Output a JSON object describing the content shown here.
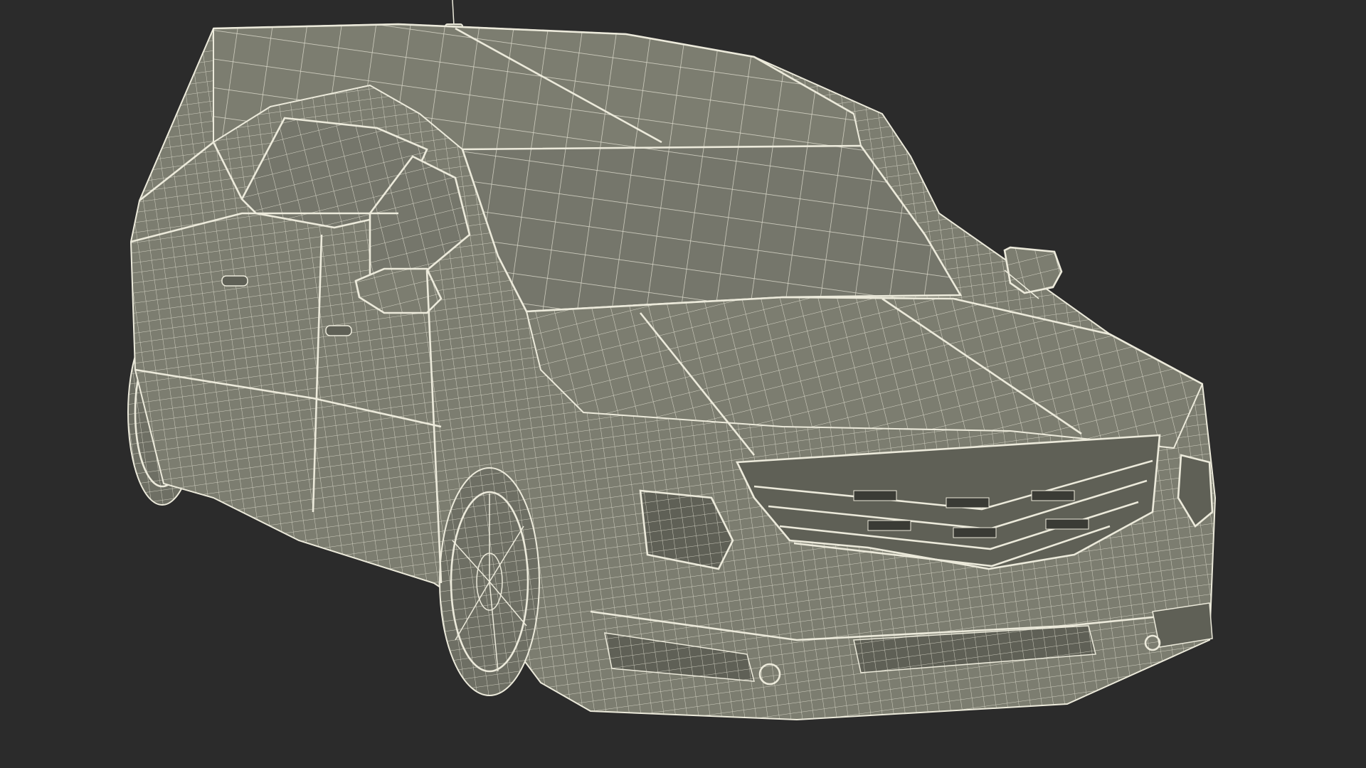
{
  "scene": {
    "subject": "car-wireframe-render",
    "background_color": "#2b2b2b",
    "body_fill": "#7c7d70",
    "body_fill_dark": "#5f6056",
    "glass_fill": "#75766b",
    "wire_color": "#eceadb",
    "grille_dark": "#3a3b35",
    "tire_fill": "#6e6f64"
  }
}
